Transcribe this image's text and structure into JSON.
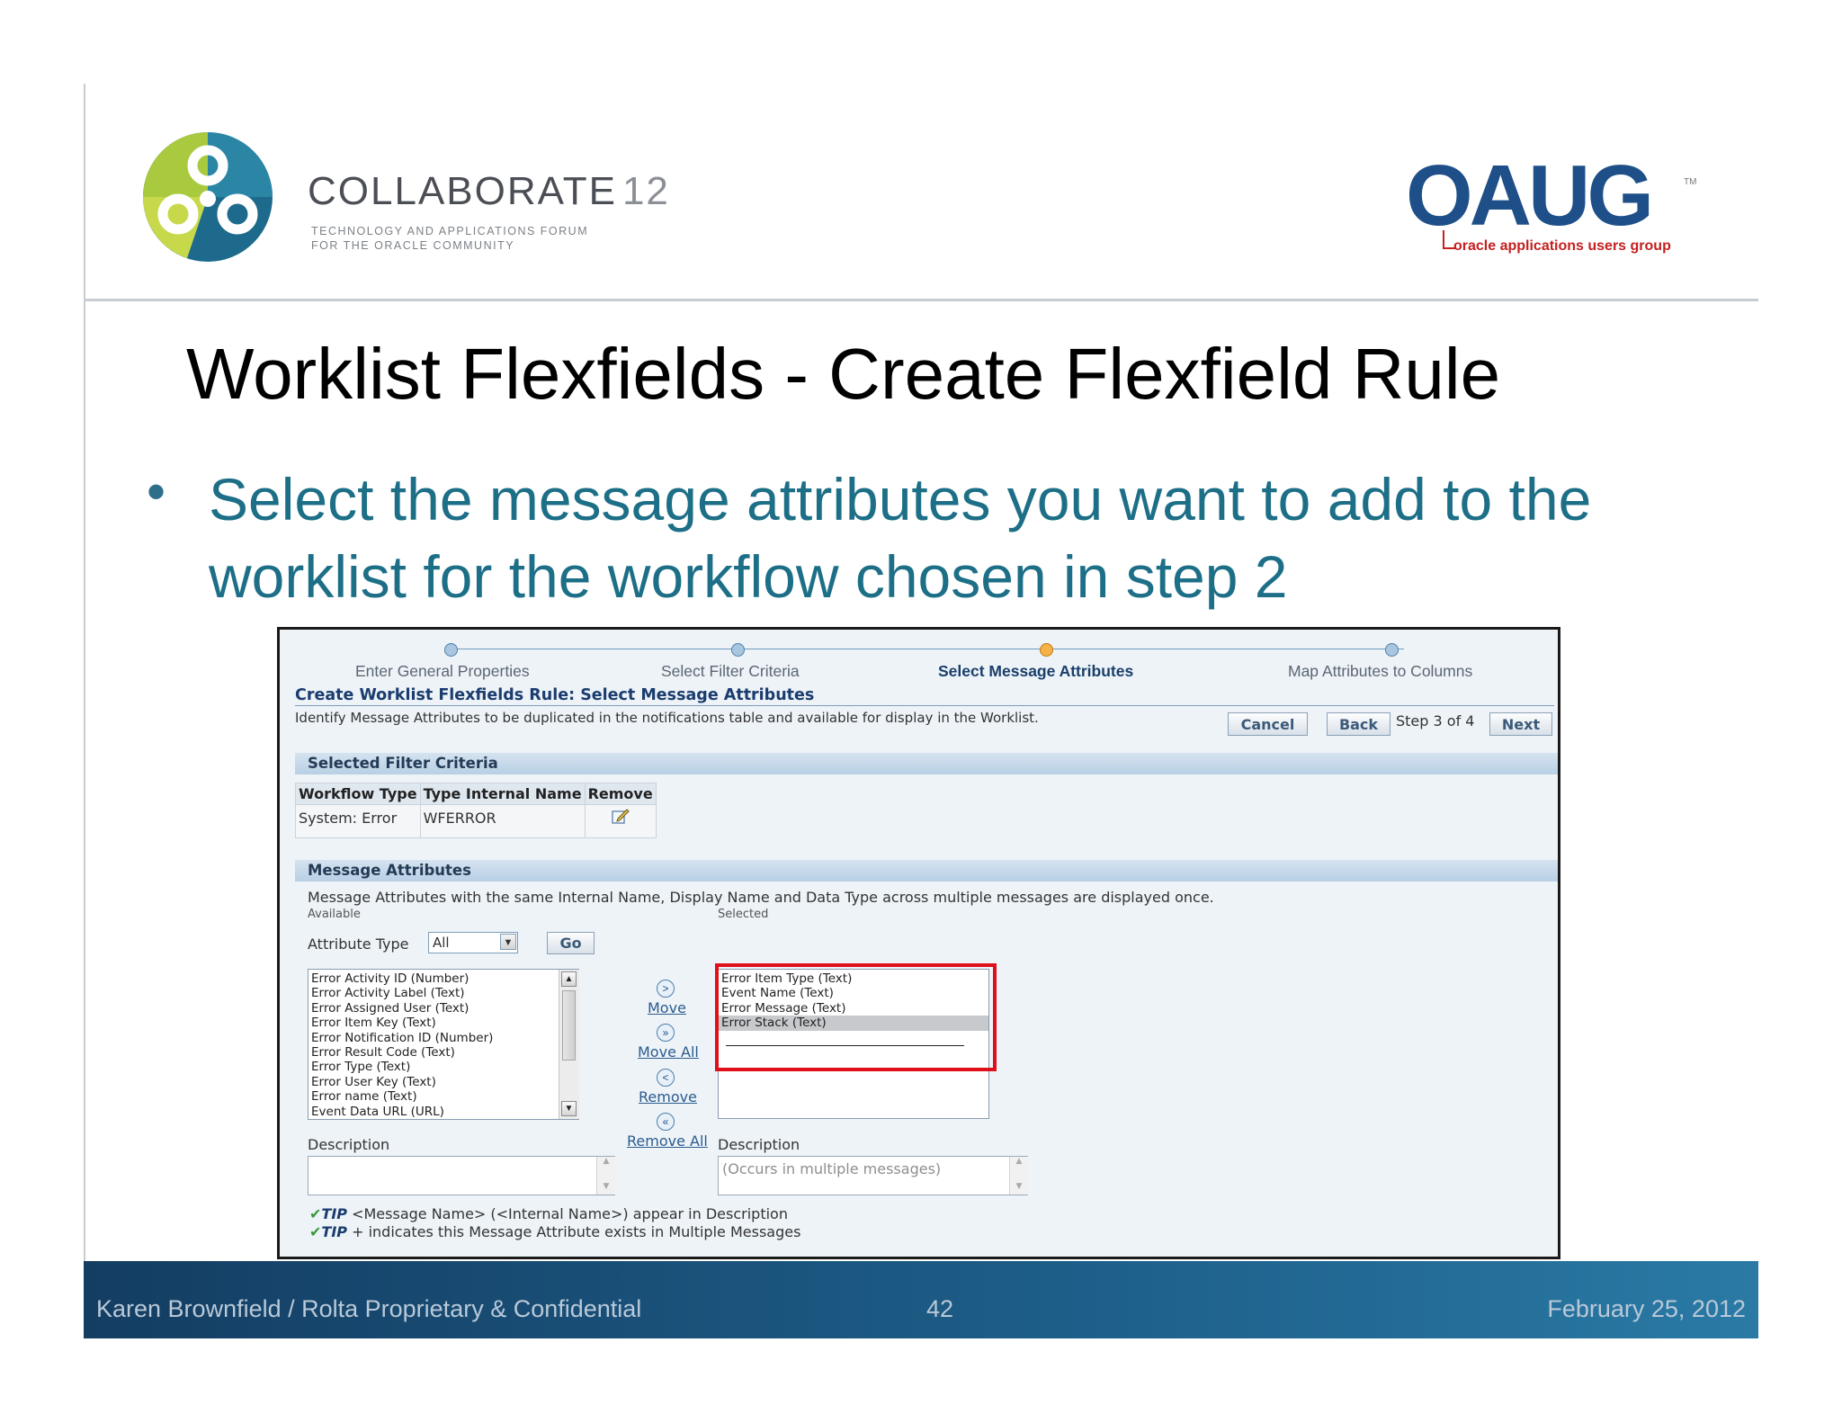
{
  "header": {
    "collaborate": {
      "word": "COLLABORATE",
      "number": "12",
      "sub_line1": "TECHNOLOGY AND APPLICATIONS FORUM",
      "sub_line2": "FOR THE ORACLE COMMUNITY"
    },
    "oaug": {
      "word": "OAUG",
      "tm": "TM",
      "tagline": "oracle applications users group"
    }
  },
  "slide": {
    "title": "Worklist Flexfields - Create Flexfield Rule",
    "bullet": "Select the message attributes you want to add to the worklist for the workflow chosen in step 2"
  },
  "app": {
    "train": [
      "Enter General Properties",
      "Select Filter Criteria",
      "Select Message Attributes",
      "Map Attributes to Columns"
    ],
    "heading": "Create Worklist Flexfields Rule: Select Message Attributes",
    "description": "Identify Message Attributes to be duplicated in the notifications table and available for display in the Worklist.",
    "buttons": {
      "cancel": "Cancel",
      "back": "Back",
      "step": "Step 3 of 4",
      "next": "Next"
    },
    "filter_section": {
      "title": "Selected Filter Criteria",
      "columns": [
        "Workflow Type",
        "Type Internal Name",
        "Remove"
      ],
      "rows": [
        {
          "workflow_type": "System: Error",
          "internal_name": "WFERROR"
        }
      ]
    },
    "message_section": {
      "title": "Message Attributes",
      "note": "Message Attributes with the same Internal Name, Display Name and Data Type across multiple messages are displayed once.",
      "available_label": "Available",
      "selected_label": "Selected",
      "attribute_type_label": "Attribute Type",
      "attribute_type_value": "All",
      "go": "Go",
      "available": [
        "Error Activity ID (Number)",
        "Error Activity Label (Text)",
        "Error Assigned User (Text)",
        "Error Item Key (Text)",
        "Error Notification ID (Number)",
        "Error Result Code (Text)",
        "Error Type (Text)",
        "Error User Key (Text)",
        "Error name (Text)",
        "Event Data URL (URL)"
      ],
      "selected": [
        "Error Item Type (Text)",
        "Event Name (Text)",
        "Error Message (Text)",
        "Error Stack (Text)"
      ],
      "shuttle": {
        "move": "Move",
        "move_all": "Move All",
        "remove": "Remove",
        "remove_all": "Remove All"
      },
      "description_label": "Description",
      "selected_description": "(Occurs in multiple messages)",
      "tip_label": "TIP",
      "tips": [
        "<Message Name> (<Internal Name>) appear in Description",
        "+ indicates this Message Attribute exists in Multiple Messages"
      ]
    }
  },
  "footer": {
    "left": "Karen Brownfield  /  Rolta  Proprietary & Confidential",
    "page": "42",
    "date": "February 25, 2012"
  },
  "colors": {
    "title_teal": "#1d6f87",
    "highlight_red": "#e0101a",
    "footer_blue": "#1d5f8a"
  }
}
